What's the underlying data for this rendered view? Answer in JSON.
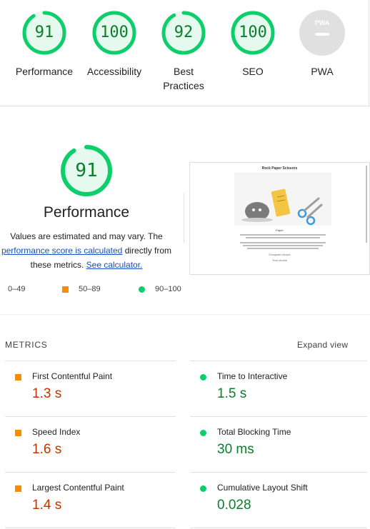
{
  "scores": [
    {
      "value": "91",
      "label": "Performance",
      "score": 0.91
    },
    {
      "value": "100",
      "label": "Accessibility",
      "score": 1.0
    },
    {
      "value": "92",
      "label": "Best Practices",
      "score": 0.92
    },
    {
      "value": "100",
      "label": "SEO",
      "score": 1.0
    },
    {
      "value": "",
      "label": "PWA",
      "badge": "PWA"
    }
  ],
  "performance": {
    "score": "91",
    "score_fraction": 0.91,
    "title": "Performance",
    "desc_1": "Values are estimated and may vary. The",
    "link_1": "performance score is calculated",
    "desc_2": " directly from",
    "desc_3": "these metrics. ",
    "link_2": "See calculator."
  },
  "legend": [
    {
      "range": "0–49",
      "color": "#e53935"
    },
    {
      "range": "50–89",
      "color": "#fb8c00"
    },
    {
      "range": "90–100",
      "color": "#0cce6b"
    }
  ],
  "thumbnail": {
    "heading": "Rock Paper Scissors",
    "caption": "Paper",
    "choice_title": "Computer choice",
    "choice_value": "Your choice"
  },
  "metrics_header": {
    "title": "METRICS",
    "expand": "Expand view"
  },
  "metrics": [
    {
      "name": "First Contentful Paint",
      "value": "1.3 s",
      "status": "average"
    },
    {
      "name": "Time to Interactive",
      "value": "1.5 s",
      "status": "pass"
    },
    {
      "name": "Speed Index",
      "value": "1.6 s",
      "status": "average"
    },
    {
      "name": "Total Blocking Time",
      "value": "30 ms",
      "status": "pass"
    },
    {
      "name": "Largest Contentful Paint",
      "value": "1.4 s",
      "status": "average"
    },
    {
      "name": "Cumulative Layout Shift",
      "value": "0.028",
      "status": "pass"
    }
  ],
  "colors": {
    "pass": "#0cce6b",
    "pass_text": "#0c7d2c",
    "average": "#fb8c00",
    "average_text": "#c33300",
    "fail": "#e53935",
    "na": "#9e9e9e"
  }
}
